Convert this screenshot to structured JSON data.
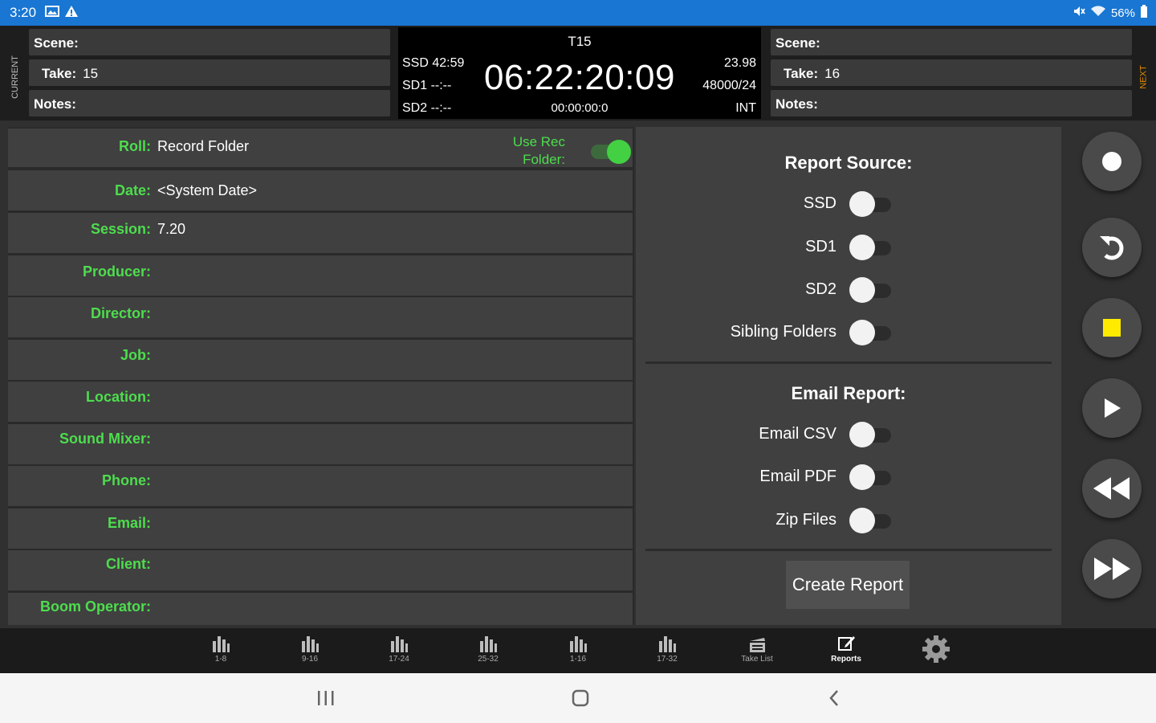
{
  "status_bar": {
    "time": "3:20",
    "battery": "56%",
    "icons": [
      "image-icon",
      "warning-icon",
      "mute-icon",
      "wifi-icon",
      "battery-icon"
    ]
  },
  "header": {
    "current_label": "CURRENT",
    "next_label": "NEXT",
    "current": {
      "scene_label": "Scene:",
      "scene_value": "",
      "take_label": "Take:",
      "take_value": "15",
      "notes_label": "Notes:",
      "notes_value": ""
    },
    "next": {
      "scene_label": "Scene:",
      "scene_value": "",
      "take_label": "Take:",
      "take_value": "16",
      "notes_label": "Notes:",
      "notes_value": ""
    },
    "timecode": {
      "take": "T15",
      "main": "06:22:20:09",
      "elapsed": "00:00:00:0",
      "ssd": "SSD 42:59",
      "sd1": "SD1 --:--",
      "sd2": "SD2 --:--",
      "fps": "23.98",
      "rate": "48000/24",
      "source": "INT"
    }
  },
  "form": {
    "use_rec_folder_label": "Use Rec Folder:",
    "use_rec_folder_on": true,
    "fields": [
      {
        "label": "Roll:",
        "value": "Record Folder"
      },
      {
        "label": "Date:",
        "value": "<System Date>"
      },
      {
        "label": "Session:",
        "value": "7.20"
      },
      {
        "label": "Producer:",
        "value": ""
      },
      {
        "label": "Director:",
        "value": ""
      },
      {
        "label": "Job:",
        "value": ""
      },
      {
        "label": "Location:",
        "value": ""
      },
      {
        "label": "Sound Mixer:",
        "value": ""
      },
      {
        "label": "Phone:",
        "value": ""
      },
      {
        "label": "Email:",
        "value": ""
      },
      {
        "label": "Client:",
        "value": ""
      },
      {
        "label": "Boom Operator:",
        "value": ""
      }
    ]
  },
  "report": {
    "source_title": "Report Source:",
    "sources": [
      {
        "label": "SSD",
        "on": false
      },
      {
        "label": "SD1",
        "on": false
      },
      {
        "label": "SD2",
        "on": false
      },
      {
        "label": "Sibling Folders",
        "on": false
      }
    ],
    "email_title": "Email Report:",
    "email_options": [
      {
        "label": "Email CSV",
        "on": false
      },
      {
        "label": "Email PDF",
        "on": false
      },
      {
        "label": "Zip Files",
        "on": false
      }
    ],
    "create_button": "Create Report"
  },
  "transport": [
    "record-icon",
    "undo-icon",
    "stop-icon",
    "play-icon",
    "rewind-icon",
    "fast-forward-icon"
  ],
  "tabs": [
    {
      "label": "1-8",
      "icon": "meters-icon"
    },
    {
      "label": "9-16",
      "icon": "meters-icon"
    },
    {
      "label": "17-24",
      "icon": "meters-icon"
    },
    {
      "label": "25-32",
      "icon": "meters-icon"
    },
    {
      "label": "1-16",
      "icon": "meters-icon"
    },
    {
      "label": "17-32",
      "icon": "meters-icon"
    },
    {
      "label": "Take List",
      "icon": "take-list-icon"
    },
    {
      "label": "Reports",
      "icon": "edit-icon",
      "active": true
    },
    {
      "label": "",
      "icon": "gear-icon"
    }
  ],
  "colors": {
    "status_bar": "#1976d2",
    "label_green": "#4ddd4d",
    "toggle_on": "#43d143",
    "stop_yellow": "#ffeb00",
    "next_label_orange": "#e08a00"
  }
}
